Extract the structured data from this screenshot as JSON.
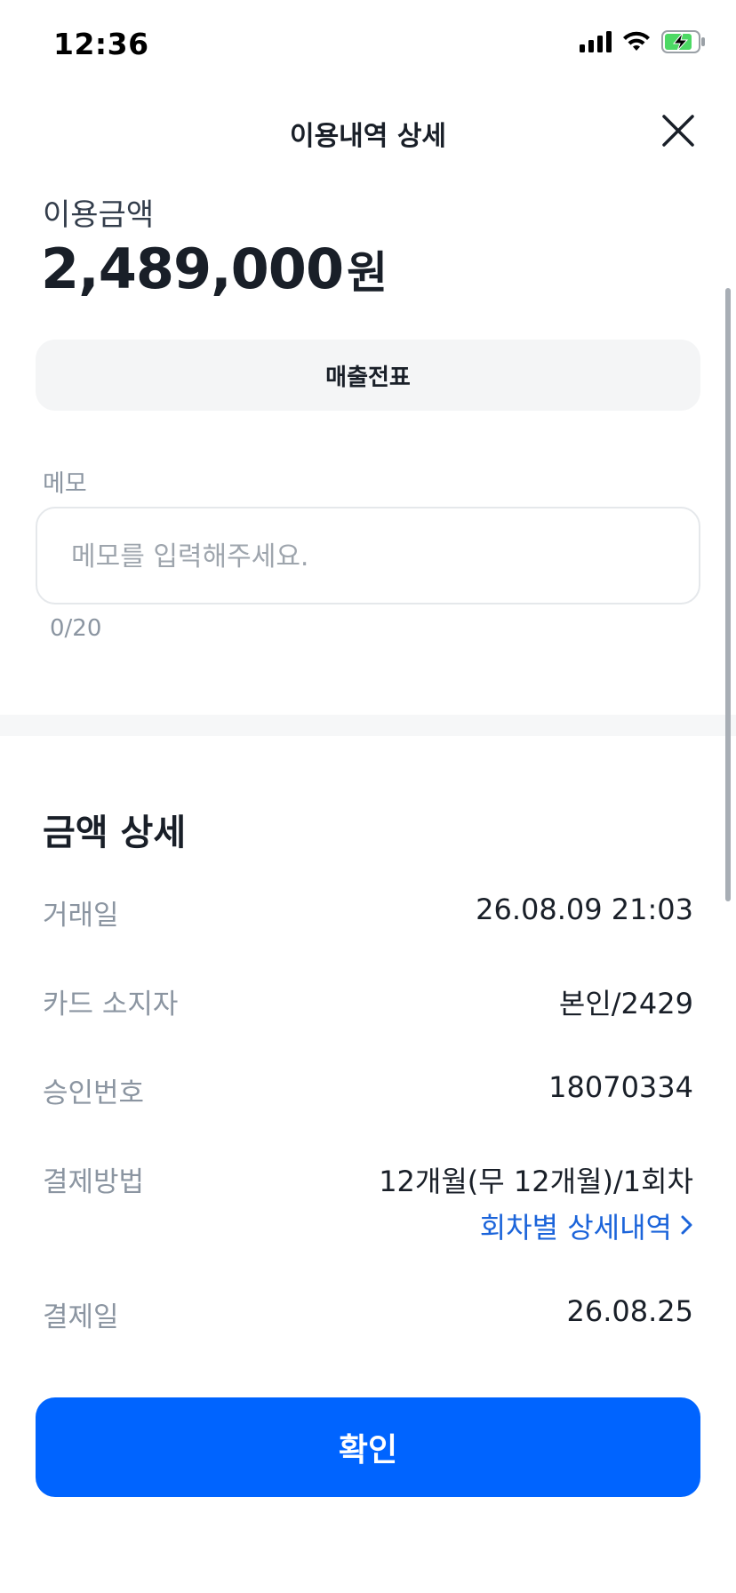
{
  "status_bar": {
    "time": "12:36",
    "icons": [
      "signal-icon",
      "wifi-icon",
      "battery-charging-icon"
    ],
    "battery_color": "#4cd964"
  },
  "header": {
    "title": "이용내역 상세",
    "close_icon": "close-icon"
  },
  "summary": {
    "amount_label": "이용금액",
    "amount": "2,489,000",
    "currency": "원"
  },
  "receipt_button_label": "매출전표",
  "memo": {
    "label": "메모",
    "value": "",
    "placeholder": "메모를 입력해주세요.",
    "counter": "0/20"
  },
  "details": {
    "title": "금액 상세",
    "rows": [
      {
        "key": "거래일",
        "value": "26.08.09 21:03"
      },
      {
        "key": "카드 소지자",
        "value": "본인/2429"
      },
      {
        "key": "승인번호",
        "value": "18070334"
      },
      {
        "key": "결제방법",
        "value": "12개월(무 12개월)/1회차",
        "link": "회차별 상세내역"
      },
      {
        "key": "결제일",
        "value": "26.08.25"
      }
    ]
  },
  "confirm_button_label": "확인",
  "colors": {
    "accent": "#0064ff",
    "link": "#1b64da",
    "muted": "#8b95a1",
    "text": "#191f28"
  }
}
